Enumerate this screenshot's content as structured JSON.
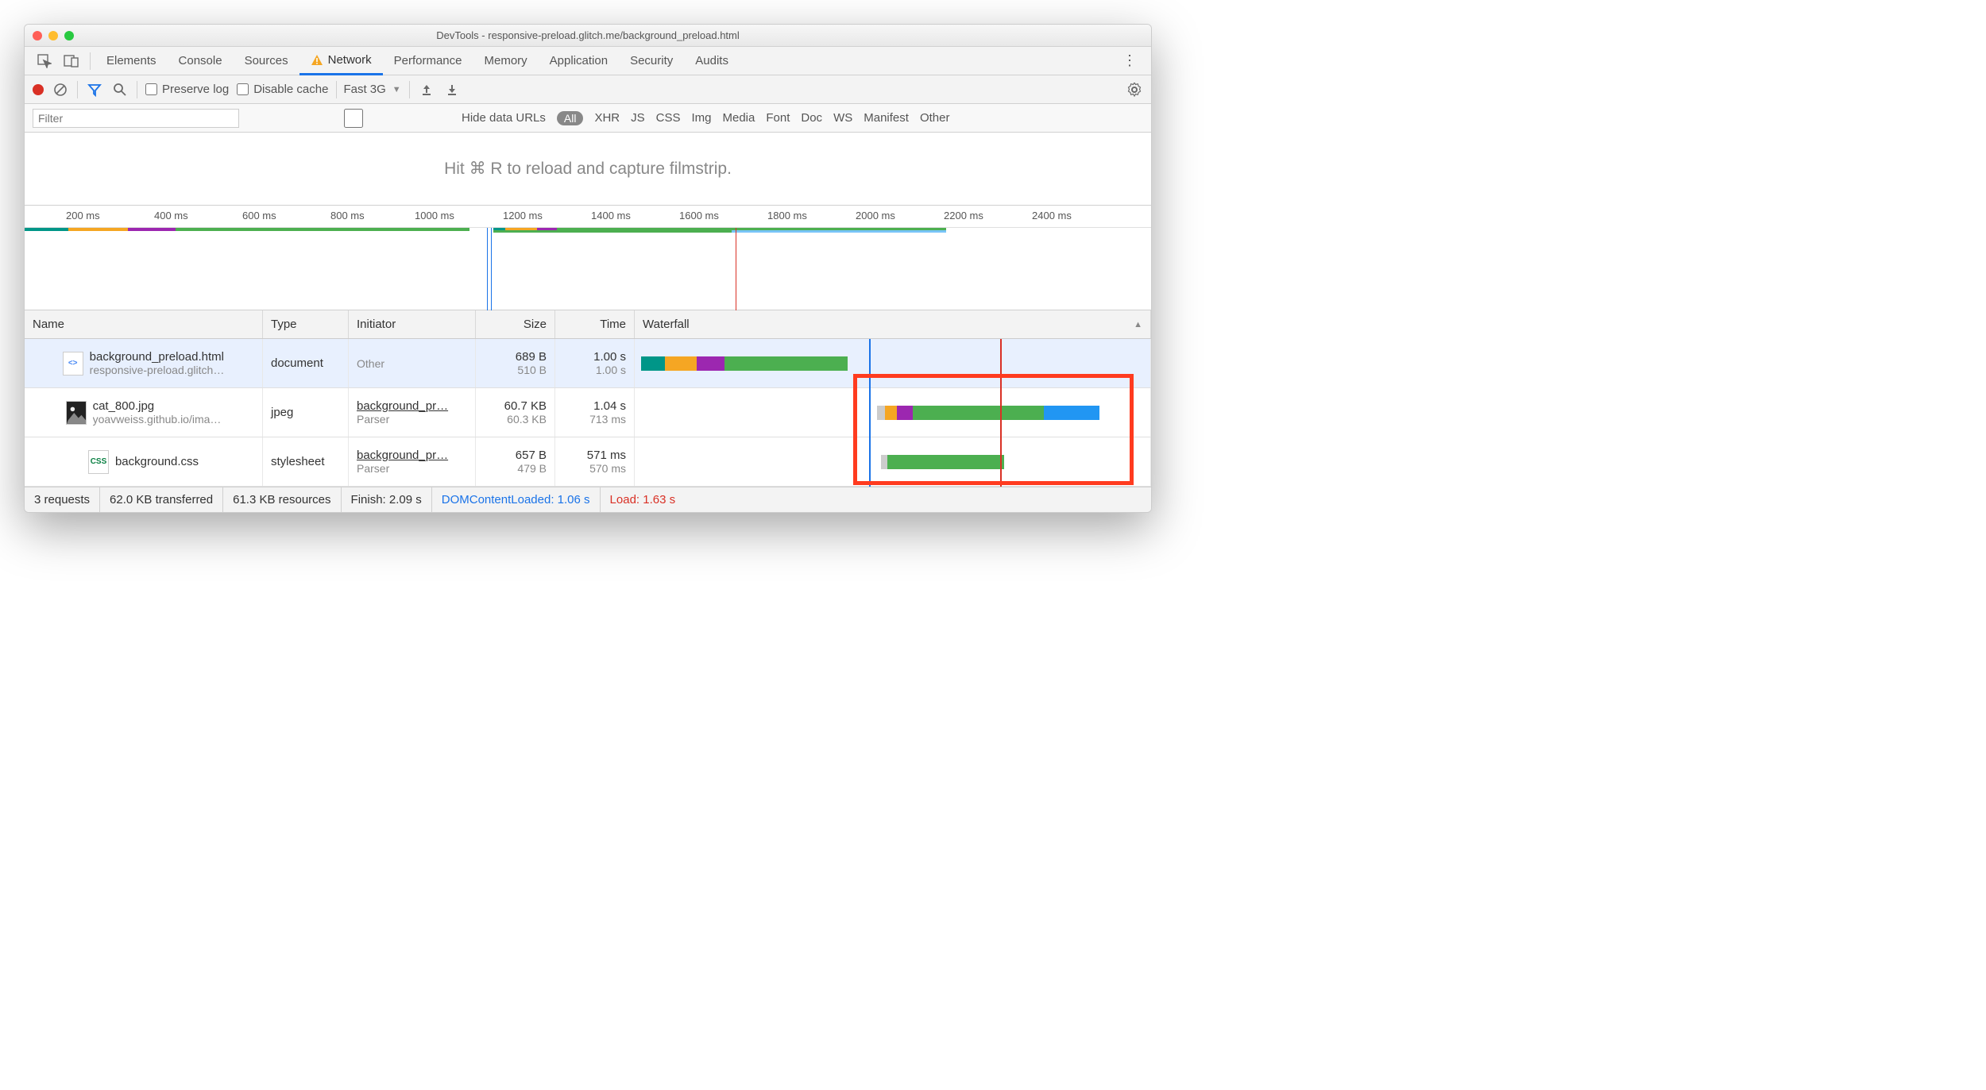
{
  "window_title": "DevTools - responsive-preload.glitch.me/background_preload.html",
  "tabs": [
    "Elements",
    "Console",
    "Sources",
    "Network",
    "Performance",
    "Memory",
    "Application",
    "Security",
    "Audits"
  ],
  "active_tab": "Network",
  "toolbar": {
    "preserve_log": "Preserve log",
    "disable_cache": "Disable cache",
    "throttle": "Fast 3G"
  },
  "filter": {
    "placeholder": "Filter",
    "hide_data_urls": "Hide data URLs",
    "all": "All",
    "types": [
      "XHR",
      "JS",
      "CSS",
      "Img",
      "Media",
      "Font",
      "Doc",
      "WS",
      "Manifest",
      "Other"
    ]
  },
  "hint": "Hit ⌘ R to reload and capture filmstrip.",
  "overview_ticks": [
    "200 ms",
    "400 ms",
    "600 ms",
    "800 ms",
    "1000 ms",
    "1200 ms",
    "1400 ms",
    "1600 ms",
    "1800 ms",
    "2000 ms",
    "2200 ms",
    "2400 ms"
  ],
  "table": {
    "headers": {
      "name": "Name",
      "type": "Type",
      "initiator": "Initiator",
      "size": "Size",
      "time": "Time",
      "waterfall": "Waterfall"
    },
    "rows": [
      {
        "name": "background_preload.html",
        "sub": "responsive-preload.glitch…",
        "type": "document",
        "initiator": "Other",
        "size": "689 B",
        "size2": "510 B",
        "time": "1.00 s",
        "time2": "1.00 s",
        "icon": "html"
      },
      {
        "name": "cat_800.jpg",
        "sub": "yoavweiss.github.io/ima…",
        "type": "jpeg",
        "initiator": "background_pr…",
        "initiator2": "Parser",
        "size": "60.7 KB",
        "size2": "60.3 KB",
        "time": "1.04 s",
        "time2": "713 ms",
        "icon": "img"
      },
      {
        "name": "background.css",
        "sub": "",
        "type": "stylesheet",
        "initiator": "background_pr…",
        "initiator2": "Parser",
        "size": "657 B",
        "size2": "479 B",
        "time": "571 ms",
        "time2": "570 ms",
        "icon": "css"
      }
    ]
  },
  "status": {
    "requests": "3 requests",
    "transferred": "62.0 KB transferred",
    "resources": "61.3 KB resources",
    "finish": "Finish: 2.09 s",
    "dcl": "DOMContentLoaded: 1.06 s",
    "load": "Load: 1.63 s"
  },
  "colors": {
    "teal": "#009688",
    "orange": "#f5a623",
    "purple": "#9c27b0",
    "green": "#4caf50",
    "blue": "#2196f3",
    "dclLine": "#1a73e8",
    "loadLine": "#d93025"
  }
}
